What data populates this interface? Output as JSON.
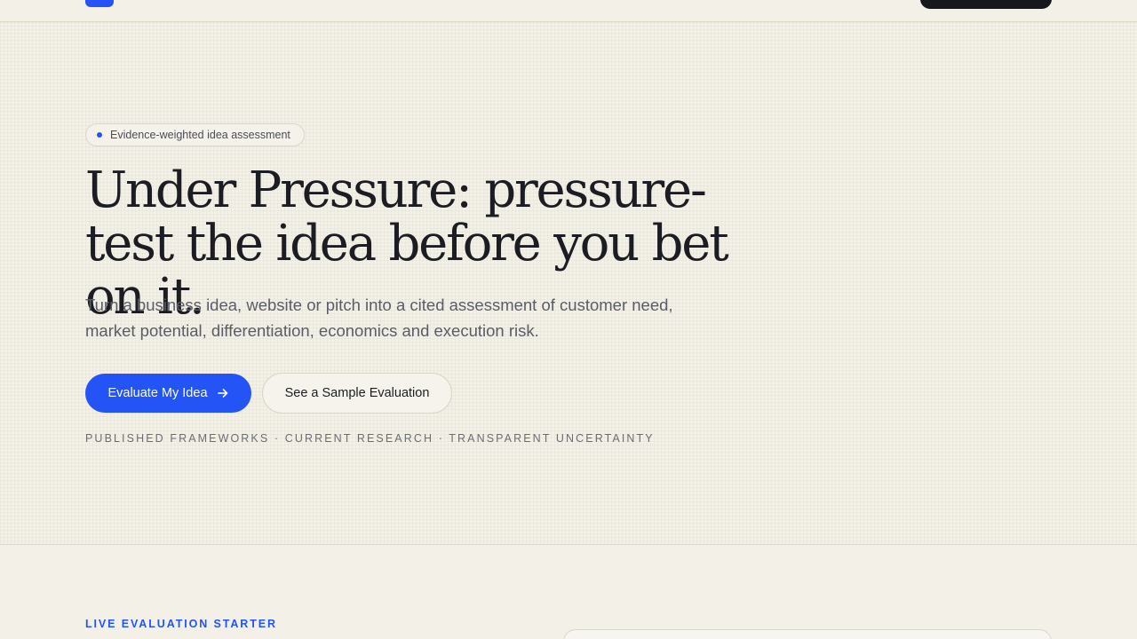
{
  "hero": {
    "badge": "Evidence-weighted idea assessment",
    "headline": "Under Pressure: pressure-test the idea before you bet on it.",
    "subtext": "Turn a business idea, website or pitch into a cited assessment of customer need, market potential, differentiation, economics and execution risk.",
    "primary_cta": "Evaluate My Idea",
    "primary_cta_icon": "arrow-right-icon",
    "secondary_cta": "See a Sample Evaluation",
    "trust_line": "PUBLISHED FRAMEWORKS · CURRENT RESEARCH · TRANSPARENT UNCERTAINTY"
  },
  "starter": {
    "label": "LIVE EVALUATION STARTER"
  },
  "colors": {
    "accent": "#2454f5",
    "background": "#f3f0e8",
    "text": "#1c1d22",
    "nav_button": "#16181d"
  }
}
